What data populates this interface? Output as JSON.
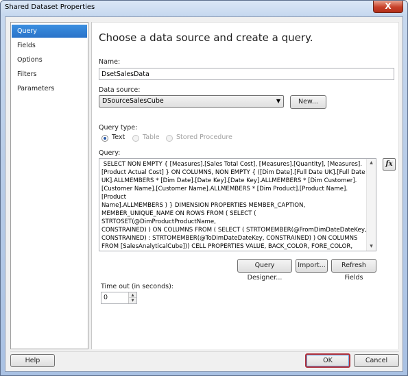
{
  "window": {
    "title": "Shared Dataset Properties",
    "close_label": "X"
  },
  "nav": {
    "items": [
      {
        "label": "Query",
        "active": true
      },
      {
        "label": "Fields",
        "active": false
      },
      {
        "label": "Options",
        "active": false
      },
      {
        "label": "Filters",
        "active": false
      },
      {
        "label": "Parameters",
        "active": false
      }
    ]
  },
  "main": {
    "heading": "Choose a data source and create a query.",
    "name_label": "Name:",
    "name_value": "DsetSalesData",
    "datasource_label": "Data source:",
    "datasource_value": "DSourceSalesCube",
    "new_button": "New...",
    "query_type_label": "Query type:",
    "query_types": [
      {
        "label": "Text",
        "checked": true,
        "enabled": true
      },
      {
        "label": "Table",
        "checked": false,
        "enabled": false
      },
      {
        "label": "Stored Procedure",
        "checked": false,
        "enabled": false
      }
    ],
    "query_label": "Query:",
    "query_text": " SELECT NON EMPTY { [Measures].[Sales Total Cost], [Measures].[Quantity], [Measures].\n[Product Actual Cost] } ON COLUMNS, NON EMPTY { ([Dim Date].[Full Date UK].[Full Date\nUK].ALLMEMBERS * [Dim Date].[Date Key].[Date Key].ALLMEMBERS * [Dim Customer].\n[Customer Name].[Customer Name].ALLMEMBERS * [Dim Product].[Product Name].[Product\nName].ALLMEMBERS ) } DIMENSION PROPERTIES MEMBER_CAPTION,\nMEMBER_UNIQUE_NAME ON ROWS FROM ( SELECT ( STRTOSET(@DimProductProductName,\nCONSTRAINED) ) ON COLUMNS FROM ( SELECT ( STRTOMEMBER(@FromDimDateDateKey,\nCONSTRAINED) : STRTOMEMBER(@ToDimDateDateKey, CONSTRAINED) ) ON COLUMNS\nFROM [SalesAnalyticalCube])) CELL PROPERTIES VALUE, BACK_COLOR, FORE_COLOR,\nFORMATTED_VALUE, FORMAT_STRING, FONT_NAME, FONT_SIZE, FONT_FLAGS",
    "fx_label": "fx",
    "query_designer_button": "Query Designer...",
    "import_button": "Import...",
    "refresh_fields_button": "Refresh Fields",
    "timeout_label": "Time out (in seconds):",
    "timeout_value": "0"
  },
  "footer": {
    "help_button": "Help",
    "ok_button": "OK",
    "cancel_button": "Cancel"
  },
  "colors": {
    "nav_active": "#2a73c9",
    "ok_highlight": "#b0303a",
    "title_bar": "#c6d8ef"
  }
}
